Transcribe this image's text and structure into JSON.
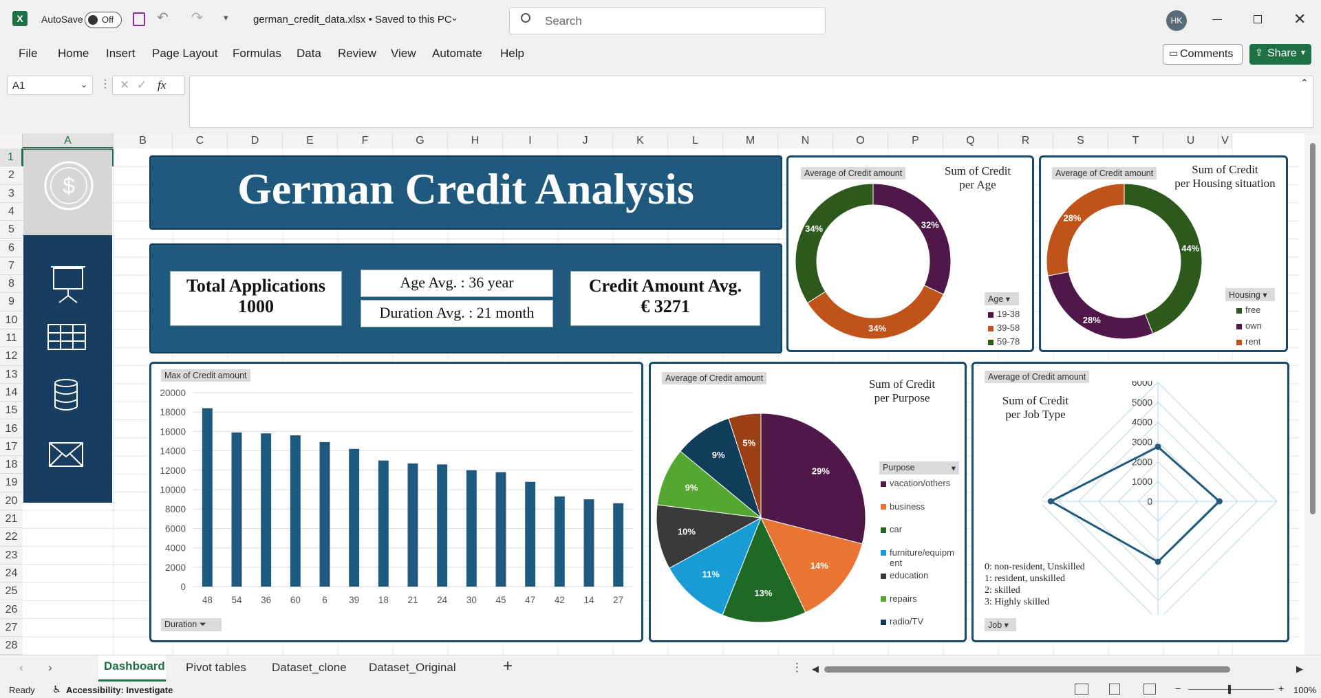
{
  "titlebar": {
    "autosave_label": "AutoSave",
    "autosave_state": "Off",
    "filename": "german_credit_data.xlsx • Saved to this PC",
    "search_placeholder": "Search",
    "user_initials": "HK"
  },
  "menu": {
    "items": [
      "File",
      "Home",
      "Insert",
      "Page Layout",
      "Formulas",
      "Data",
      "Review",
      "View",
      "Automate",
      "Help"
    ],
    "comments_label": "Comments",
    "share_label": "Share"
  },
  "formula": {
    "name_box": "A1",
    "fx": "fx",
    "value": ""
  },
  "columns": [
    "A",
    "B",
    "C",
    "D",
    "E",
    "F",
    "G",
    "H",
    "I",
    "J",
    "K",
    "L",
    "M",
    "N",
    "O",
    "P",
    "Q",
    "R",
    "S",
    "T",
    "U",
    "V"
  ],
  "rows": [
    "1",
    "2",
    "3",
    "4",
    "5",
    "6",
    "7",
    "8",
    "9",
    "10",
    "11",
    "12",
    "13",
    "14",
    "15",
    "16",
    "17",
    "18",
    "19",
    "20",
    "21",
    "22",
    "23",
    "24",
    "25",
    "26",
    "27",
    "28"
  ],
  "dashboard": {
    "title": "German Credit Analysis",
    "kpi": {
      "total_label": "Total Applications",
      "total_value": "1000",
      "age_avg": "Age Avg. : 36 year",
      "duration_avg": "Duration Avg. : 21 month",
      "credit_label": "Credit Amount Avg.",
      "credit_value": "€ 3271"
    },
    "sidebar_icons": [
      "dollar-icon",
      "presentation-icon",
      "table-icon",
      "database-icon",
      "mail-icon"
    ]
  },
  "chart_data": [
    {
      "type": "pie",
      "donut": true,
      "title": "Sum of Credit per Age",
      "field_button": "Average of Credit amount",
      "filter_label": "Age",
      "categories": [
        "19-38",
        "39-58",
        "59-78"
      ],
      "values": [
        32,
        34,
        34
      ],
      "labels": [
        "32%",
        "34%",
        "34%"
      ],
      "colors": [
        "#4f1848",
        "#c0531a",
        "#2d5a1c"
      ]
    },
    {
      "type": "pie",
      "donut": true,
      "title": "Sum of Credit per Housing situation",
      "field_button": "Average of Credit amount",
      "filter_label": "Housing",
      "categories": [
        "free",
        "own",
        "rent"
      ],
      "values": [
        44,
        28,
        28
      ],
      "labels": [
        "44%",
        "28%",
        "28%"
      ],
      "colors": [
        "#2d5a1c",
        "#4f1848",
        "#c0531a"
      ]
    },
    {
      "type": "bar",
      "field_button": "Max of Credit amount",
      "filter_label": "Duration",
      "categories": [
        "48",
        "54",
        "36",
        "60",
        "6",
        "39",
        "18",
        "21",
        "24",
        "30",
        "45",
        "47",
        "42",
        "14",
        "27"
      ],
      "values": [
        18400,
        15900,
        15800,
        15600,
        14900,
        14200,
        13000,
        12700,
        12600,
        12000,
        11800,
        10800,
        9300,
        9000,
        8600
      ],
      "yticks": [
        "0",
        "2000",
        "4000",
        "6000",
        "8000",
        "10000",
        "12000",
        "14000",
        "16000",
        "18000",
        "20000"
      ],
      "ylim": [
        0,
        20000
      ],
      "color": "#1f5a7e"
    },
    {
      "type": "pie",
      "title": "Sum of Credit per Purpose",
      "field_button": "Average of Credit amount",
      "filter_label": "Purpose",
      "categories": [
        "vacation/others",
        "business",
        "car",
        "furniture/equipment",
        "education",
        "repairs",
        "radio/TV"
      ],
      "values": [
        29,
        14,
        13,
        11,
        10,
        9,
        9,
        5
      ],
      "labels": [
        "29%",
        "14%",
        "13%",
        "11%",
        "10%",
        "9%",
        "9%",
        "5%"
      ],
      "legend_display": [
        "vacation/others",
        "business",
        "car",
        "furniture/equipm ent",
        "education",
        "repairs",
        "radio/TV"
      ],
      "colors": [
        "#4f1848",
        "#ea7431",
        "#1e6a25",
        "#199cd6",
        "#3a3a3a",
        "#54a832",
        "#0f3d5a",
        "#9b4016"
      ]
    },
    {
      "type": "radar",
      "title": "Sum of Credit per Job Type",
      "field_button": "Average of Credit amount",
      "filter_label": "Job",
      "categories": [
        "0",
        "1",
        "2",
        "3"
      ],
      "values": [
        2750,
        3100,
        3050,
        5400
      ],
      "rticks": [
        "0",
        "1000",
        "2000",
        "3000",
        "4000",
        "5000",
        "6000"
      ],
      "rlim": [
        0,
        6000
      ],
      "notes": [
        "0: non-resident, Unskilled",
        "1: resident, unskilled",
        "2: skilled",
        "3: Highly skilled"
      ],
      "color": "#1f5a7e"
    }
  ],
  "tabs": {
    "items": [
      "Dashboard",
      "Pivot tables",
      "Dataset_clone",
      "Dataset_Original"
    ],
    "active": "Dashboard",
    "add": "+"
  },
  "status": {
    "ready": "Ready",
    "accessibility": "Accessibility: Investigate",
    "zoom": "100%"
  }
}
